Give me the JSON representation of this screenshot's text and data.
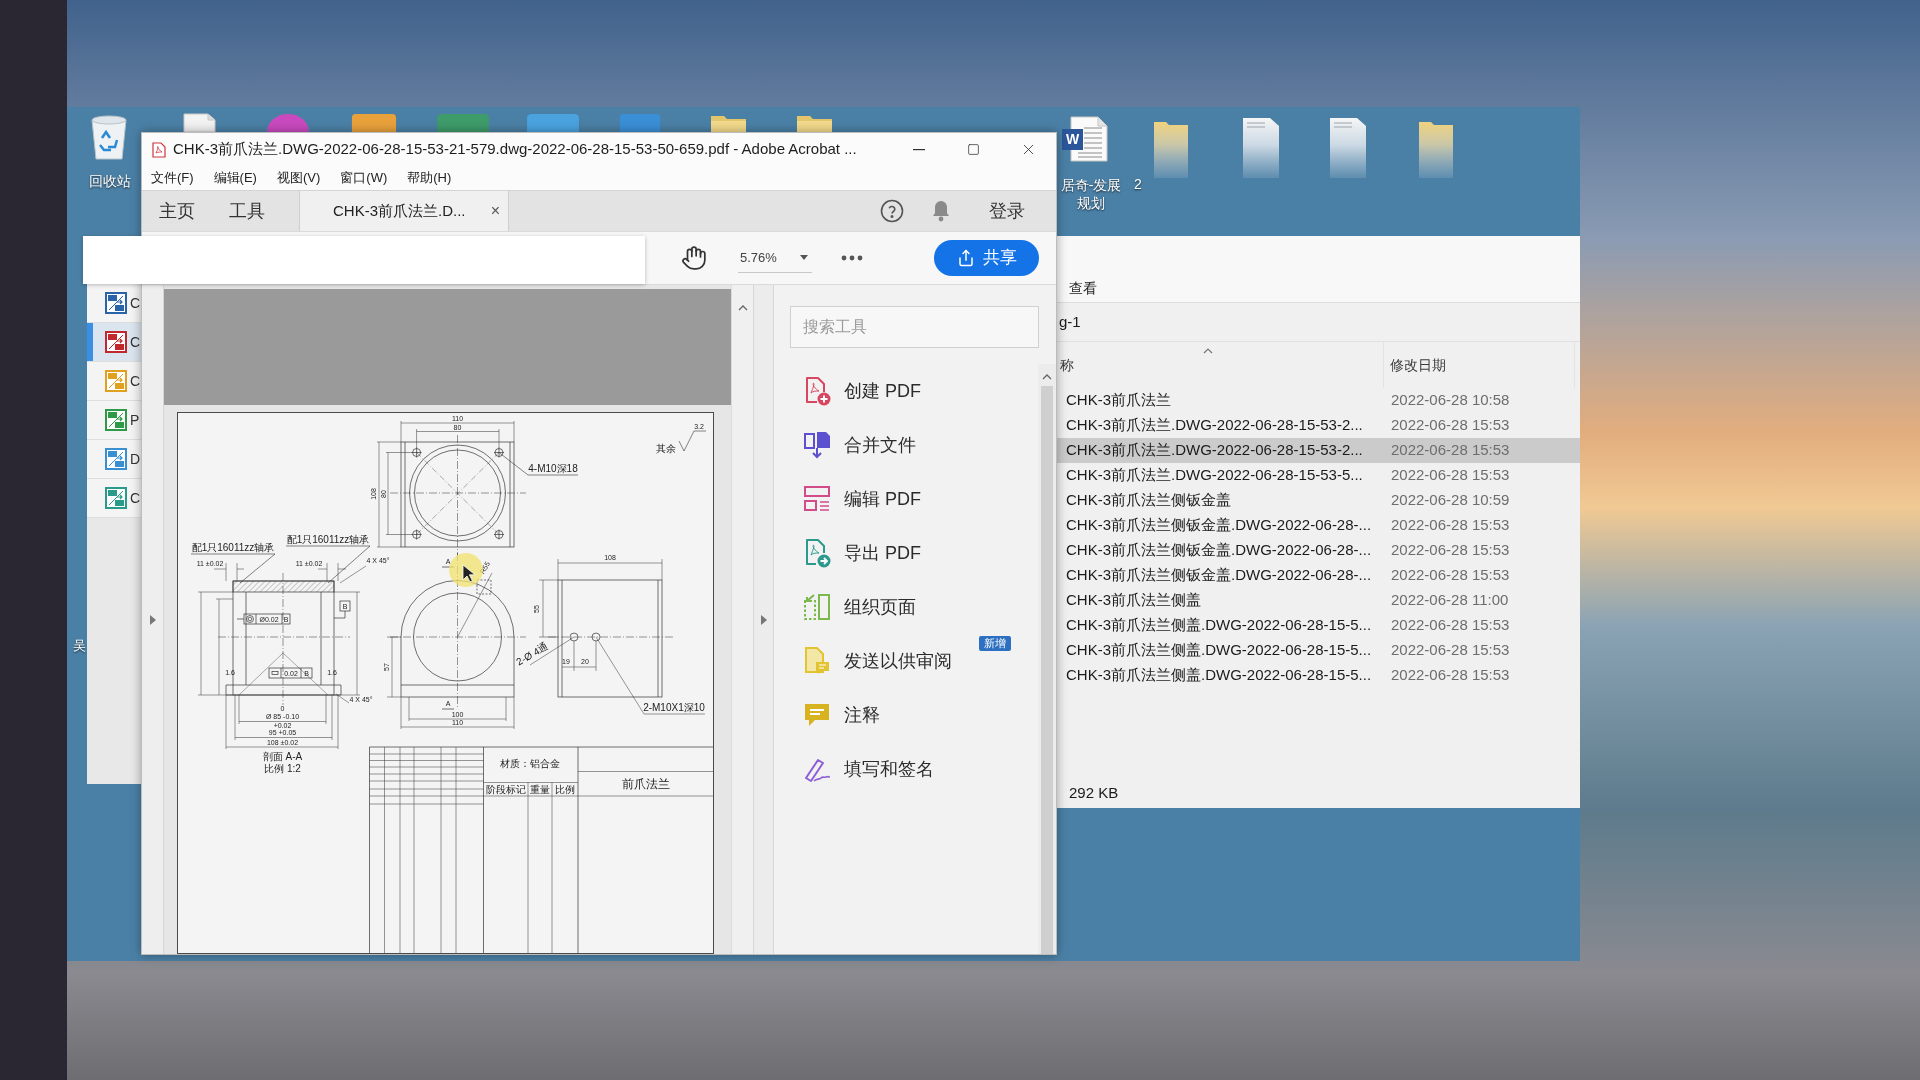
{
  "desktop": {
    "top_icons": [
      {
        "kind": "document"
      },
      {
        "kind": "orb",
        "color": "#c94abf"
      },
      {
        "kind": "tile",
        "color": "#e9a23b"
      },
      {
        "kind": "tile",
        "color": "#3e9b6a"
      },
      {
        "kind": "tile",
        "color": "#4aa3df"
      },
      {
        "kind": "tile",
        "color": "#3b8fd6"
      },
      {
        "kind": "folder"
      },
      {
        "kind": "folder"
      }
    ],
    "left_icons": [
      {
        "kind": "recycle-bin",
        "label": "回收站"
      },
      {
        "kind": "label-only",
        "label": "吴"
      }
    ],
    "right_icons": [
      {
        "kind": "word",
        "label": "居奇-发展规划",
        "badge": "W"
      },
      {
        "kind": "folder",
        "label": "2"
      },
      {
        "kind": "document"
      },
      {
        "kind": "document"
      },
      {
        "kind": "folder"
      }
    ]
  },
  "converter": {
    "items": [
      {
        "label": "C",
        "color": "#2a63a8",
        "selected": false
      },
      {
        "label": "C",
        "color": "#c0282e",
        "selected": true
      },
      {
        "label": "C",
        "color": "#e0a020",
        "selected": false
      },
      {
        "label": "P",
        "color": "#2e9a48",
        "selected": false
      },
      {
        "label": "D",
        "color": "#3a8fd0",
        "selected": false
      },
      {
        "label": "C",
        "color": "#2a9a8a",
        "selected": false
      }
    ]
  },
  "explorer": {
    "ribbon_tab": "查看",
    "address": "g-1",
    "columns": [
      "称",
      "修改日期"
    ],
    "rows": [
      {
        "name": "CHK-3前爪法兰",
        "modified": "2022-06-28 10:58",
        "selected": false
      },
      {
        "name": "CHK-3前爪法兰.DWG-2022-06-28-15-53-2...",
        "modified": "2022-06-28 15:53",
        "selected": false
      },
      {
        "name": "CHK-3前爪法兰.DWG-2022-06-28-15-53-2...",
        "modified": "2022-06-28 15:53",
        "selected": true
      },
      {
        "name": "CHK-3前爪法兰.DWG-2022-06-28-15-53-5...",
        "modified": "2022-06-28 15:53",
        "selected": false
      },
      {
        "name": "CHK-3前爪法兰侧钣金盖",
        "modified": "2022-06-28 10:59",
        "selected": false
      },
      {
        "name": "CHK-3前爪法兰侧钣金盖.DWG-2022-06-28-...",
        "modified": "2022-06-28 15:53",
        "selected": false
      },
      {
        "name": "CHK-3前爪法兰侧钣金盖.DWG-2022-06-28-...",
        "modified": "2022-06-28 15:53",
        "selected": false
      },
      {
        "name": "CHK-3前爪法兰侧钣金盖.DWG-2022-06-28-...",
        "modified": "2022-06-28 15:53",
        "selected": false
      },
      {
        "name": "CHK-3前爪法兰侧盖",
        "modified": "2022-06-28 11:00",
        "selected": false
      },
      {
        "name": "CHK-3前爪法兰侧盖.DWG-2022-06-28-15-5...",
        "modified": "2022-06-28 15:53",
        "selected": false
      },
      {
        "name": "CHK-3前爪法兰侧盖.DWG-2022-06-28-15-5...",
        "modified": "2022-06-28 15:53",
        "selected": false
      },
      {
        "name": "CHK-3前爪法兰侧盖.DWG-2022-06-28-15-5...",
        "modified": "2022-06-28 15:53",
        "selected": false
      }
    ],
    "status": "292 KB"
  },
  "acrobat": {
    "title": "CHK-3前爪法兰.DWG-2022-06-28-15-53-21-579.dwg-2022-06-28-15-53-50-659.pdf - Adobe Acrobat ...",
    "menu": [
      "文件(F)",
      "编辑(E)",
      "视图(V)",
      "窗口(W)",
      "帮助(H)"
    ],
    "tabs": [
      {
        "label": "主页",
        "selected": false
      },
      {
        "label": "工具",
        "selected": false
      },
      {
        "label": "CHK-3前爪法兰.D...",
        "selected": true,
        "close": "×"
      }
    ],
    "sign_in": "登录",
    "toolbar": {
      "zoom": "5.76%",
      "share": "共享"
    },
    "page": {
      "labels": [
        {
          "kind": "dimension",
          "text": "110"
        },
        {
          "kind": "dimension",
          "text": "80"
        },
        {
          "kind": "dimension",
          "text": "3.2"
        },
        {
          "kind": "note",
          "text": "其余"
        },
        {
          "kind": "note",
          "text": "4-M10深18"
        },
        {
          "kind": "dimension",
          "text": "108"
        },
        {
          "kind": "dimension",
          "text": "80"
        },
        {
          "kind": "note",
          "text": "配1只16011zz轴承"
        },
        {
          "kind": "note",
          "text": "配1只16011zz轴承"
        },
        {
          "kind": "dimension",
          "text": "11 ±0.02"
        },
        {
          "kind": "dimension",
          "text": "11 ±0.02"
        },
        {
          "kind": "dimension",
          "text": "4 X 45°"
        },
        {
          "kind": "dimension",
          "text": "B"
        },
        {
          "kind": "dimension",
          "text": "Ø0.02"
        },
        {
          "kind": "dimension",
          "text": "B"
        },
        {
          "kind": "dimension",
          "text": "1.6"
        },
        {
          "kind": "dimension",
          "text": "0.02"
        },
        {
          "kind": "dimension",
          "text": "B"
        },
        {
          "kind": "dimension",
          "text": "1.6"
        },
        {
          "kind": "dimension",
          "text": "4 X 45°"
        },
        {
          "kind": "dimension",
          "text": "0"
        },
        {
          "kind": "dimension",
          "text": "Ø 85 -0.10"
        },
        {
          "kind": "dimension",
          "text": "+0.02"
        },
        {
          "kind": "dimension",
          "text": "95 +0.05"
        },
        {
          "kind": "dimension",
          "text": "108 ±0.02"
        },
        {
          "kind": "caption",
          "text": "剖面 A-A"
        },
        {
          "kind": "caption",
          "text": "比例 1:2"
        },
        {
          "kind": "dimension",
          "text": "A"
        },
        {
          "kind": "dimension",
          "text": "R55"
        },
        {
          "kind": "dimension",
          "text": "57"
        },
        {
          "kind": "dimension",
          "text": "A"
        },
        {
          "kind": "dimension",
          "text": "100"
        },
        {
          "kind": "dimension",
          "text": "110"
        },
        {
          "kind": "dimension",
          "text": "108"
        },
        {
          "kind": "dimension",
          "text": "55"
        },
        {
          "kind": "note",
          "text": "2-Ø 4通"
        },
        {
          "kind": "dimension",
          "text": "19"
        },
        {
          "kind": "dimension",
          "text": "20"
        },
        {
          "kind": "note",
          "text": "2-M10X1深10"
        },
        {
          "kind": "title",
          "text": "材质：铝合金"
        },
        {
          "kind": "title",
          "text": "阶段标记"
        },
        {
          "kind": "title",
          "text": "重量"
        },
        {
          "kind": "title",
          "text": "比例"
        },
        {
          "kind": "title",
          "text": "前爪法兰"
        }
      ]
    },
    "tools_pane": {
      "search": {
        "placeholder": "搜索工具"
      },
      "tools": [
        {
          "kind": "create",
          "label": "创建 PDF"
        },
        {
          "kind": "combine",
          "label": "合并文件"
        },
        {
          "kind": "edit",
          "label": "编辑 PDF"
        },
        {
          "kind": "export",
          "label": "导出 PDF"
        },
        {
          "kind": "organize",
          "label": "组织页面"
        },
        {
          "kind": "review",
          "label": "发送以供审阅",
          "badge": "新增"
        },
        {
          "kind": "comment",
          "label": "注释"
        },
        {
          "kind": "sign",
          "label": "填写和签名"
        }
      ]
    }
  }
}
